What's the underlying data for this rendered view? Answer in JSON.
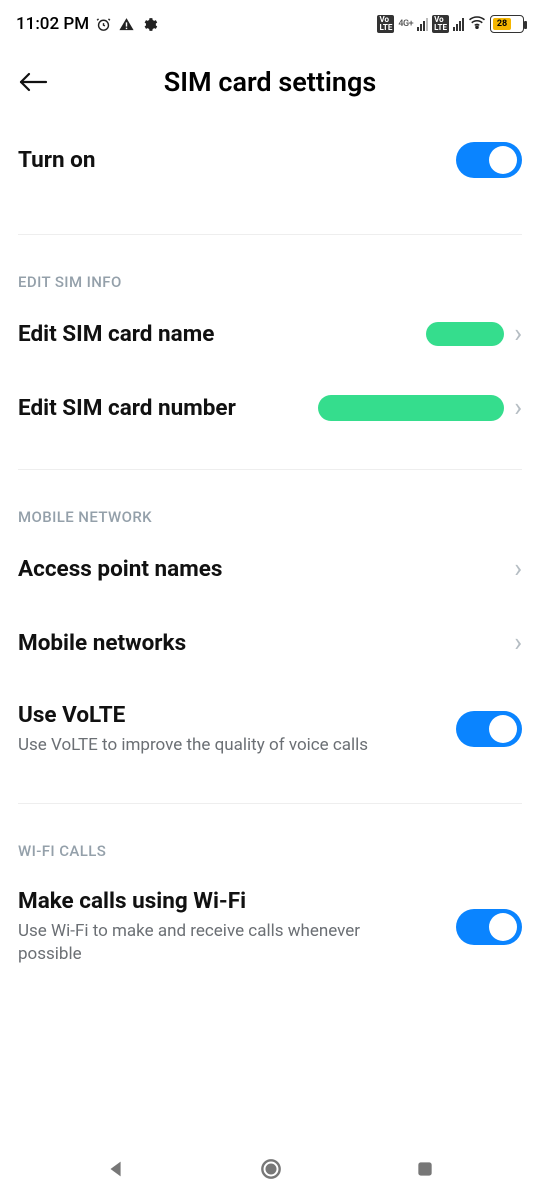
{
  "status": {
    "time": "11:02 PM",
    "battery_percent": "28",
    "network_label_1": "Vo LTE",
    "network_label_2": "4G+",
    "network_label_3": "Vo LTE"
  },
  "header": {
    "title": "SIM card settings"
  },
  "top": {
    "turn_on_label": "Turn on"
  },
  "sections": {
    "edit_sim_info": {
      "header": "EDIT SIM INFO",
      "edit_name_label": "Edit SIM card name",
      "edit_number_label": "Edit SIM card number"
    },
    "mobile_network": {
      "header": "MOBILE NETWORK",
      "apn_label": "Access point names",
      "mobile_networks_label": "Mobile networks",
      "volte_label": "Use VoLTE",
      "volte_sub": "Use VoLTE to improve the quality of voice calls"
    },
    "wifi_calls": {
      "header": "WI-FI CALLS",
      "wifi_call_label": "Make calls using Wi-Fi",
      "wifi_call_sub": "Use Wi-Fi to make and receive calls whenever possible"
    }
  }
}
